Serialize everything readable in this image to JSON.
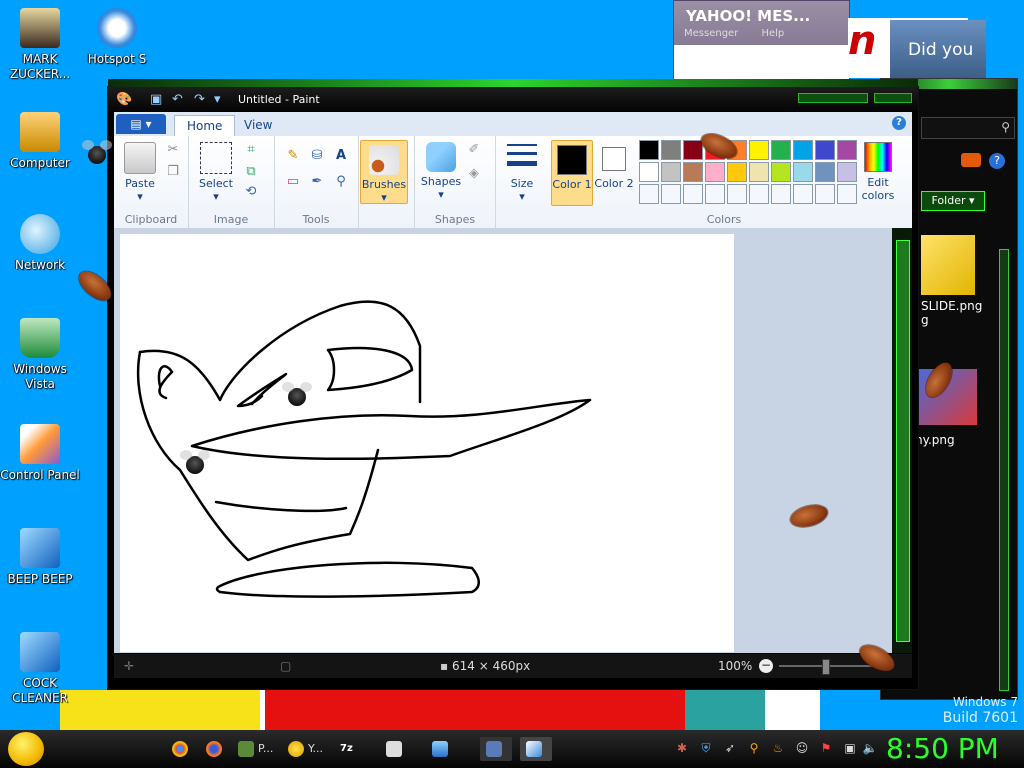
{
  "desktop": {
    "icons": [
      {
        "label": "MARK ZUCKER..."
      },
      {
        "label": "Hotspot S"
      },
      {
        "label": "Computer"
      },
      {
        "label": "Network"
      },
      {
        "label": "Windows Vista"
      },
      {
        "label": "Control Panel"
      },
      {
        "label": "BEEP BEEP"
      },
      {
        "label": "COCK CLEANER"
      }
    ],
    "watermark_line1": "Windows 7",
    "watermark_line2": "Build 7601"
  },
  "messenger": {
    "title": "YAHOO! MES...",
    "menu": "Messenger Help",
    "ad_text": "n t",
    "photo_caption": "Did you"
  },
  "explorer": {
    "folder_button": "Folder ▾",
    "file1": "SLIDE.png",
    "file1_wrap": "g",
    "file2": "ny.png"
  },
  "paint": {
    "title": "Untitled - Paint",
    "tabs": {
      "file": "▤ ▾",
      "home": "Home",
      "view": "View"
    },
    "groups": {
      "clipboard": "Clipboard",
      "image": "Image",
      "tools": "Tools",
      "shapes": "Shapes",
      "colors": "Colors"
    },
    "buttons": {
      "paste": "Paste",
      "select": "Select",
      "brushes": "Brushes",
      "shapes": "Shapes",
      "size": "Size",
      "color1": "Color 1",
      "color2": "Color 2",
      "edit_colors": "Edit colors"
    },
    "palette_row1": [
      "#000000",
      "#7f7f7f",
      "#880015",
      "#ed1c24",
      "#ff7f27",
      "#fff200",
      "#22b14c",
      "#00a2e8",
      "#3f48cc",
      "#a349a4"
    ],
    "palette_row2": [
      "#ffffff",
      "#c3c3c3",
      "#b97a57",
      "#ffaec9",
      "#ffc90e",
      "#efe4b0",
      "#b5e61d",
      "#99d9ea",
      "#7092be",
      "#c8bfe7"
    ],
    "status": {
      "dimensions": "614 × 460px",
      "zoom": "100%"
    }
  },
  "taskbar": {
    "items": [
      {
        "label": "P..."
      },
      {
        "label": "Y..."
      }
    ],
    "clock": "8:50 PM"
  }
}
